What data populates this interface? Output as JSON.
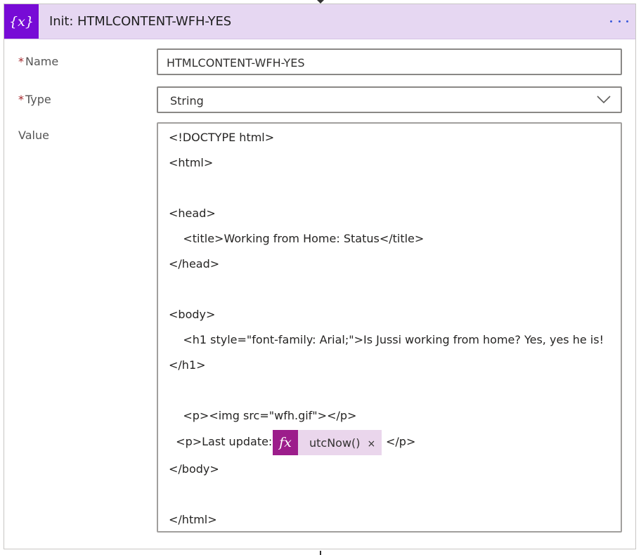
{
  "action": {
    "title": "Init: HTMLCONTENT-WFH-YES",
    "icon": "variable-icon",
    "icon_text": "{x}",
    "accent_color": "#770bd6",
    "header_bg": "#e6d7f2"
  },
  "fields": {
    "name": {
      "required_mark": "*",
      "label": "Name",
      "value": "HTMLCONTENT-WFH-YES"
    },
    "type": {
      "required_mark": "*",
      "label": "Type",
      "value": "String"
    },
    "value": {
      "label": "Value",
      "lines": [
        "<!DOCTYPE html>",
        "<html>",
        "",
        "<head>",
        "    <title>Working from Home: Status</title>",
        "</head>",
        "",
        "<body>",
        "    <h1 style=\"font-family: Arial;\">Is Jussi working from home? Yes, yes he is!",
        "</h1>",
        "",
        "    <p><img src=\"wfh.gif\"></p>",
        "  <p>Last update: ",
        "</body>",
        "",
        "</html>"
      ],
      "expression": {
        "icon_text": "fx",
        "text": "utcNow()",
        "close": "×",
        "after": "</p>",
        "token_color": "#9c1d8b",
        "token_bg": "#ead6ec"
      }
    }
  }
}
